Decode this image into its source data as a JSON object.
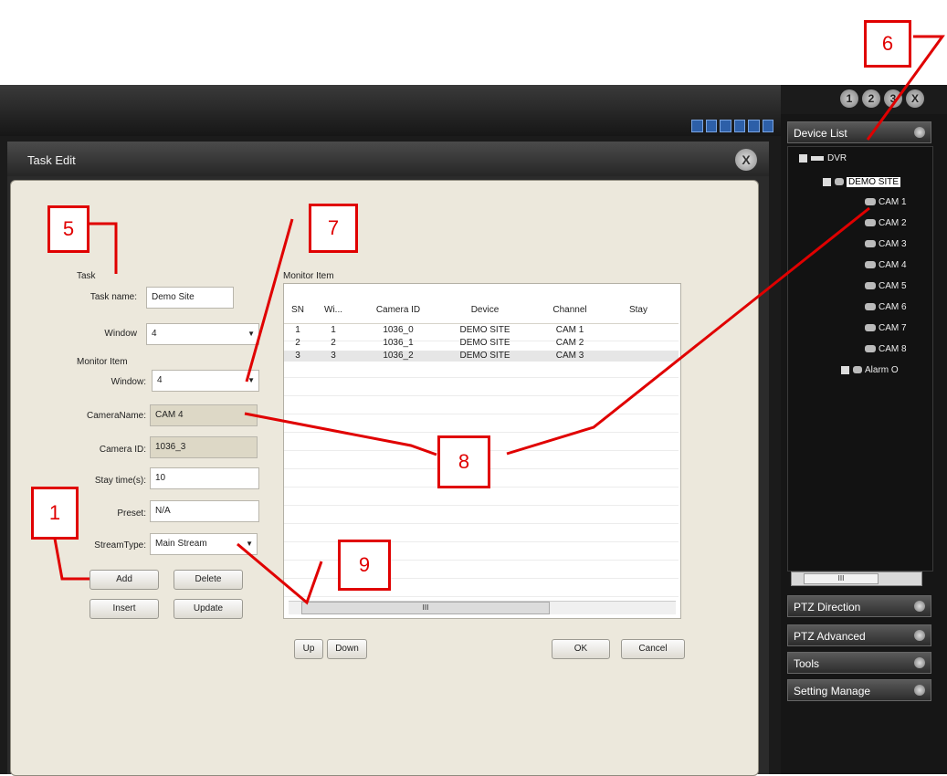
{
  "app": {
    "window_controls": [
      "1",
      "2",
      "3",
      "X"
    ]
  },
  "dialog": {
    "title": "Task Edit",
    "close_label": "X",
    "task_group": "Task",
    "task_name_label": "Task name:",
    "task_name_value": "Demo Site",
    "window_label": "Window",
    "window_value": "4",
    "monitor_item_group": "Monitor Item",
    "mi_window_label": "Window:",
    "mi_window_value": "4",
    "camera_name_label": "CameraName:",
    "camera_name_value": "CAM 4",
    "camera_id_label": "Camera ID:",
    "camera_id_value": "1036_3",
    "stay_time_label": "Stay time(s):",
    "stay_time_value": "10",
    "preset_label": "Preset:",
    "preset_value": "N/A",
    "stream_type_label": "StreamType:",
    "stream_type_value": "Main Stream",
    "buttons": {
      "add": "Add",
      "delete": "Delete",
      "insert": "Insert",
      "update": "Update",
      "up": "Up",
      "down": "Down",
      "ok": "OK",
      "cancel": "Cancel"
    },
    "monitor_table": {
      "title": "Monitor Item",
      "columns": [
        "SN",
        "Wi...",
        "Camera ID",
        "Device",
        "Channel",
        "Stay"
      ],
      "rows": [
        {
          "sn": "1",
          "window": "1",
          "camera_id": "1036_0",
          "device": "DEMO SITE",
          "channel": "CAM 1",
          "stay": ""
        },
        {
          "sn": "2",
          "window": "2",
          "camera_id": "1036_1",
          "device": "DEMO SITE",
          "channel": "CAM 2",
          "stay": ""
        },
        {
          "sn": "3",
          "window": "3",
          "camera_id": "1036_2",
          "device": "DEMO SITE",
          "channel": "CAM 3",
          "stay": ""
        }
      ],
      "scroll_marker": "III"
    }
  },
  "right_panel": {
    "device_list_header": "Device List",
    "tree": {
      "root": "DVR",
      "site": "DEMO SITE",
      "cameras": [
        "CAM 1",
        "CAM 2",
        "CAM 3",
        "CAM 4",
        "CAM 5",
        "CAM 6",
        "CAM 7",
        "CAM 8"
      ],
      "alarm": "Alarm O"
    },
    "tree_scroll_marker": "III",
    "sections": [
      "PTZ Direction",
      "PTZ Advanced",
      "Tools",
      "Setting Manage"
    ]
  },
  "annotations": [
    "1",
    "5",
    "6",
    "7",
    "8",
    "9"
  ],
  "colors": {
    "annotation_red": "#e00000",
    "dialog_bg": "#ece8dc",
    "app_dark": "#1b1b1b"
  }
}
